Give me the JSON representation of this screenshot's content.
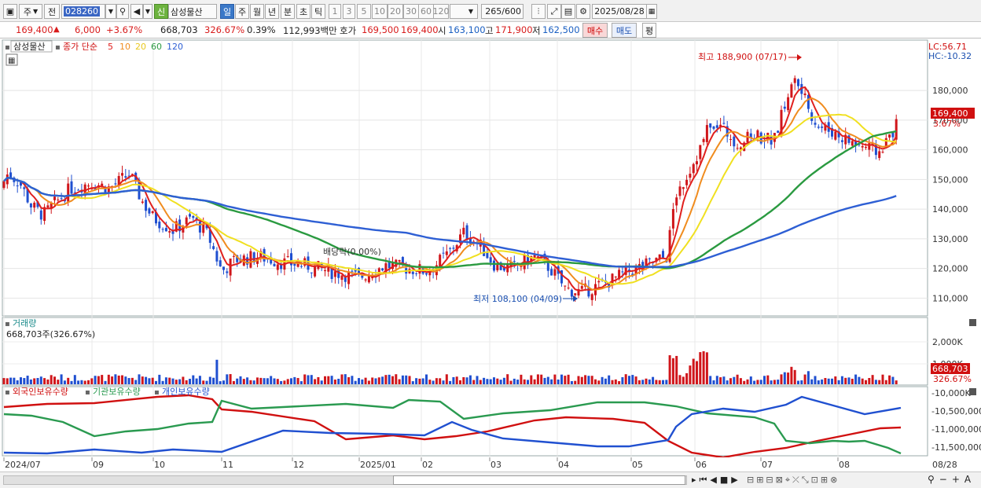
{
  "toolbar": {
    "type_label": "주",
    "prev_label": "전",
    "code_value": "028260",
    "name_badge": "신",
    "stock_name": "삼성물산",
    "periods": [
      "일",
      "주",
      "월",
      "년",
      "분",
      "초",
      "틱"
    ],
    "active_period": "일",
    "intervals": [
      "1",
      "3",
      "5",
      "10",
      "20",
      "30",
      "60",
      "120"
    ],
    "count_value": "265",
    "count_total": "/600",
    "date_value": "2025/08/28"
  },
  "quote": {
    "price": "169,400",
    "change_arrow": "▲",
    "change": "6,000",
    "change_pct": "+3.67%",
    "volume": "668,703",
    "volume_ratio": "326.67%",
    "turnover_pct": "0.39%",
    "amount": "112,993백만",
    "bid_label": "호가",
    "ask_price": "169,500",
    "bid_price": "169,400",
    "open_label": "시",
    "open": "163,100",
    "high_label": "고",
    "high": "171,900",
    "low_label": "저",
    "low": "162,500",
    "buy_label": "매수",
    "sell_label": "매도",
    "eval_label": "평"
  },
  "price_panel": {
    "stock_tag": "삼성물산",
    "ma_title": "종가 단순",
    "ma_periods": [
      {
        "label": "5",
        "color": "#e0201e"
      },
      {
        "label": "10",
        "color": "#f08c1e"
      },
      {
        "label": "20",
        "color": "#f0d21e"
      },
      {
        "label": "60",
        "color": "#2a9a40"
      },
      {
        "label": "120",
        "color": "#2e5fd4"
      }
    ],
    "lc": "LC:56.71",
    "hc": "HC:-10.32",
    "y_ticks": [
      "180,000",
      "170,000",
      "160,000",
      "150,000",
      "140,000",
      "130,000",
      "120,000",
      "110,000"
    ],
    "y_tick_values": [
      180000,
      170000,
      160000,
      150000,
      140000,
      130000,
      120000,
      110000
    ],
    "current_label": "169,400",
    "current_pct": "3.67%",
    "high_annotation": "최고 188,900 (07/17)",
    "low_annotation": "최저 108,100 (04/09)",
    "dividend_annotation": "배당락(0.00%)"
  },
  "volume_panel": {
    "title": "거래량",
    "subtitle": "668,703주(326.67%)",
    "y_ticks": [
      "2,000K",
      "1,000K"
    ],
    "current_label": "668,703",
    "current_pct": "326.67%"
  },
  "holdings_panel": {
    "legend": [
      {
        "label": "외국인보유수량",
        "color": "#d01010"
      },
      {
        "label": "기관보유수량",
        "color": "#2a9a50"
      },
      {
        "label": "개인보유수량",
        "color": "#2050d0"
      }
    ],
    "y_ticks": [
      "-10,000K",
      "-10,500,000",
      "-11,000,000",
      "-11,500,000"
    ]
  },
  "x_axis": {
    "labels": [
      "2024/07",
      "09",
      "10",
      "11",
      "12",
      "2025/01",
      "02",
      "03",
      "04",
      "05",
      "06",
      "07",
      "08"
    ],
    "end_label": "08/28"
  },
  "chart_data": {
    "type": "candlestick",
    "y_range": [
      104000,
      197000
    ],
    "high": {
      "value": 188900,
      "date": "07/17"
    },
    "low": {
      "value": 108100,
      "date": "04/09"
    },
    "last_close": 169400,
    "moving_averages": [
      5,
      10,
      20,
      60,
      120
    ]
  }
}
